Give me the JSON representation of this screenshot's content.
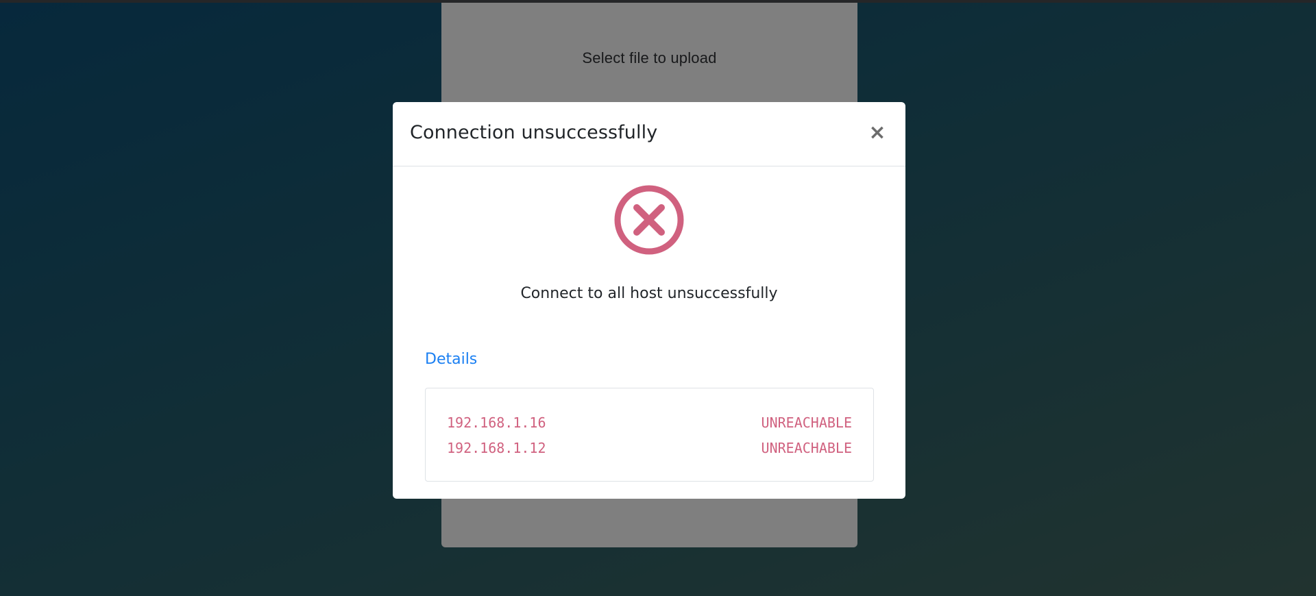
{
  "upload": {
    "title": "Select file to upload"
  },
  "modal": {
    "title": "Connection unsuccessfully",
    "close_label": "×",
    "icon": "error-circle-x-icon",
    "message": "Connect to all host unsuccessfully",
    "details_label": "Details",
    "hosts": [
      {
        "ip": "192.168.1.16",
        "status": "UNREACHABLE"
      },
      {
        "ip": "192.168.1.12",
        "status": "UNREACHABLE"
      }
    ]
  },
  "colors": {
    "error": "#d0617f",
    "link": "#1a7ff2",
    "title_text": "#212529"
  }
}
